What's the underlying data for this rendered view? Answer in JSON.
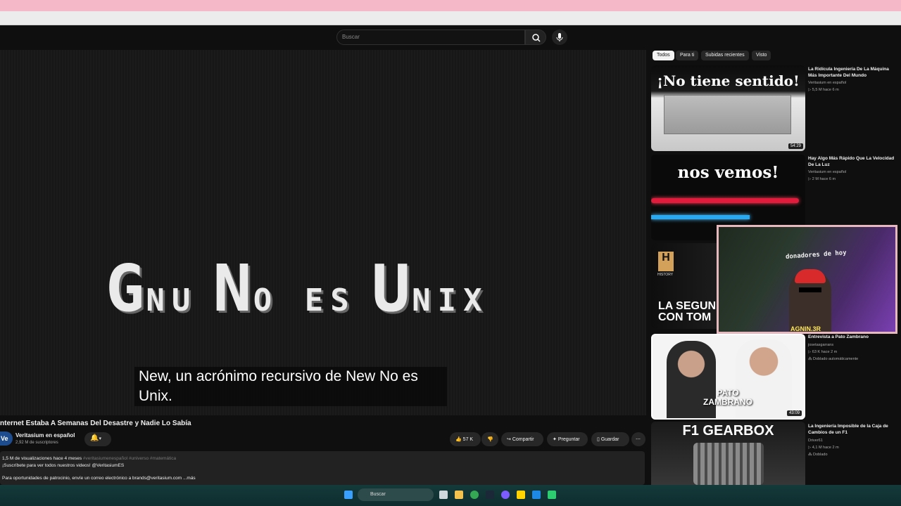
{
  "search": {
    "placeholder": "Buscar"
  },
  "video": {
    "title_line1": "Gnu No es Unix",
    "subtitle_line1": "New, un acrónimo recursivo de New No es",
    "subtitle_line2": "Unix."
  },
  "meta": {
    "title": "nternet Estaba A Semanas Del Desastre y Nadie Lo Sabía",
    "avatar_text": "Ve",
    "channel": "Veritasium en español",
    "subscribers": "2,92 M de suscriptores",
    "likes": "57 K",
    "share": "Compartir",
    "ask": "Preguntar",
    "save": "Guardar",
    "views_line": "1,5 M de visualizaciones  hace 4 meses",
    "tags": "#veritasiumenespañol #universo #matemática",
    "desc_line1": "¡Suscríbete para ver todos nuestros videos! @VeritasiumES",
    "desc_line2": "Para oportunidades de patrocinio, envíe un correo electrónico a brands@veritasium.com  ...más"
  },
  "chips": [
    "Todos",
    "Para ti",
    "Subidas recientes",
    "Visto"
  ],
  "related": [
    {
      "title": "La Ridícula Ingeniería De La Máquina Más Importante Del Mundo",
      "channel": "Veritasium en español",
      "stats": "5,5 M  hace 6 m",
      "duration": "54:29",
      "thumb_text": "¡No tiene sentido!"
    },
    {
      "title": "Hay Algo Más Rápido Que La Velocidad De La Luz",
      "channel": "Veritasium en español",
      "stats": "2 M  hace 6 m",
      "thumb_text": "nos vemos!"
    },
    {
      "thumb_text_1": "LA SEGUN",
      "thumb_text_2": "CON TOM",
      "logo": "H",
      "logo_caption": "HISTORY"
    },
    {
      "title": "Entrevista a Pato Zambrano",
      "channel": "josetasgarrans",
      "stats": "63 K  hace 2 m",
      "badge": "Doblado automáticamente",
      "duration": "43:09",
      "thumb_text_1": "PATO",
      "thumb_text_2": "ZAMBRANO"
    },
    {
      "title": "La Ingeniería Imposible de la Caja de Cambios de un F1",
      "channel": "Driver61",
      "stats": "4,1 M  hace 2 m",
      "badge": "Doblado",
      "thumb_text": "F1 GEARBOX"
    }
  ],
  "overlay": {
    "label": "donadores de hoy",
    "tag": "AGNIN.3R"
  },
  "taskbar": {
    "search": "Buscar"
  }
}
